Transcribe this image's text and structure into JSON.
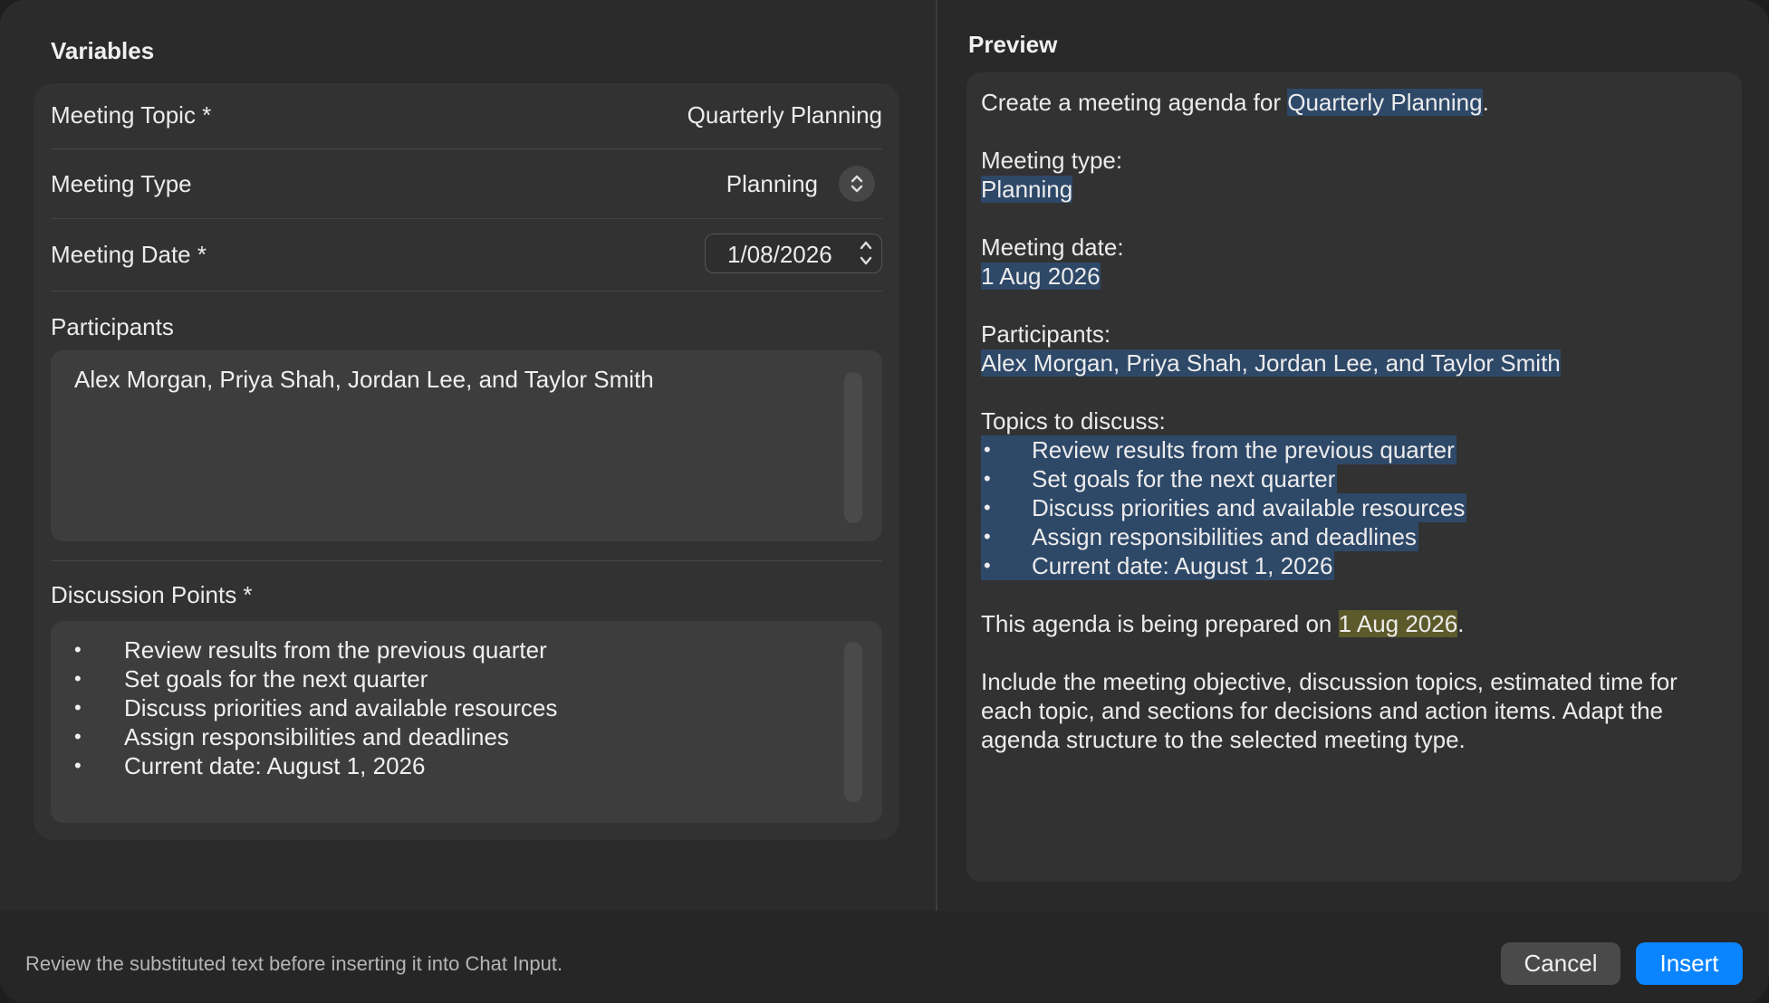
{
  "variables": {
    "title": "Variables",
    "meeting_topic": {
      "label": "Meeting Topic *",
      "value": "Quarterly Planning"
    },
    "meeting_type": {
      "label": "Meeting Type",
      "value": "Planning"
    },
    "meeting_date": {
      "label": "Meeting Date *",
      "value": "1/08/2026"
    },
    "participants": {
      "label": "Participants",
      "value": "Alex Morgan, Priya Shah, Jordan Lee, and Taylor Smith"
    },
    "discussion_points": {
      "label": "Discussion Points *",
      "items": [
        "Review results from the previous quarter",
        "Set goals for the next quarter",
        "Discuss priorities and available resources",
        "Assign responsibilities and deadlines",
        "Current date: August 1, 2026"
      ]
    }
  },
  "preview": {
    "title": "Preview",
    "line1_prefix": "Create a meeting agenda for ",
    "line1_topic": "Quarterly Planning",
    "line1_suffix": ".",
    "type_label": "Meeting type:",
    "type_value": "Planning",
    "date_label": "Meeting date:",
    "date_value": "1 Aug 2026",
    "participants_label": "Participants:",
    "participants_value": "Alex Morgan, Priya Shah, Jordan Lee, and Taylor Smith",
    "topics_label": "Topics to discuss:",
    "topics": [
      "Review results from the previous quarter",
      "Set goals for the next quarter",
      "Discuss priorities and available resources",
      "Assign responsibilities and deadlines",
      "Current date: August 1, 2026"
    ],
    "prepared_prefix": "This agenda is being prepared on ",
    "prepared_date": "1 Aug 2026",
    "prepared_suffix": ".",
    "instructions": "Include the meeting objective, discussion topics, estimated time for each topic, and sections for decisions and action items. Adapt the agenda structure to the selected meeting type."
  },
  "footer": {
    "hint": "Review the substituted text before inserting it into Chat Input.",
    "cancel_label": "Cancel",
    "insert_label": "Insert"
  },
  "colors": {
    "highlight_blue": "#2e4868",
    "highlight_yellow": "#5c5a2a",
    "accent": "#0b84ff"
  }
}
